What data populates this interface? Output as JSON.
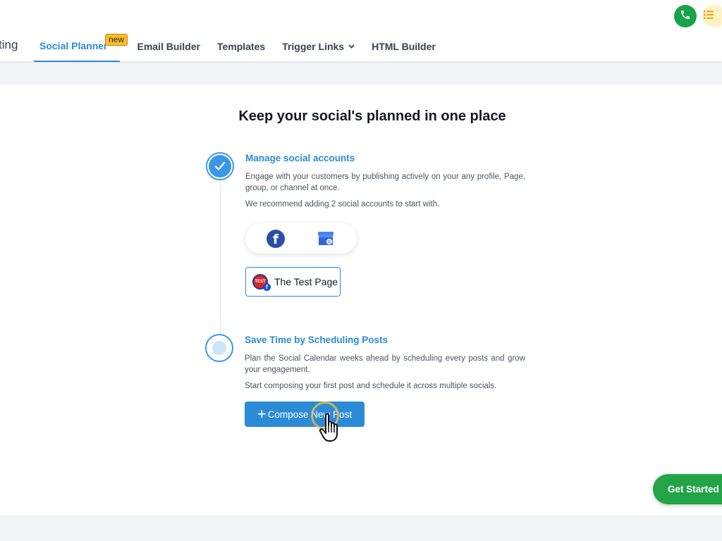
{
  "colors": {
    "accent": "#2b8bd6",
    "badge": "#fbbf24",
    "call_green": "#16a34a",
    "get_started_green": "#22a447"
  },
  "header": {
    "truncated_nav_text": "ting",
    "nav": [
      {
        "label": "Social Planner",
        "badge": "new",
        "active": true
      },
      {
        "label": "Email Builder"
      },
      {
        "label": "Templates"
      },
      {
        "label": "Trigger Links",
        "icon": "chevron-down-icon"
      },
      {
        "label": "HTML Builder"
      }
    ],
    "actions": [
      {
        "icon": "phone-icon"
      },
      {
        "icon": "list-icon"
      }
    ]
  },
  "main": {
    "headline": "Keep your social's planned in one place",
    "steps": [
      {
        "title": "Manage social accounts",
        "description": "Engage with your customers by publishing actively on your any profile, Page, group, or channel at once.",
        "note": "We recommend adding 2 social accounts to start with.",
        "status": "complete",
        "social_options": [
          {
            "icon": "facebook-icon",
            "glyph": "f"
          },
          {
            "icon": "google-business-icon"
          }
        ],
        "connected_page": {
          "name": "The Test Page",
          "avatar_text": "TEST",
          "network_glyph": "f"
        }
      },
      {
        "title": "Save Time by Scheduling Posts",
        "description": "Plan the Social Calendar weeks ahead by scheduling every posts and grow your engagement.",
        "note": "Start composing your first post and schedule it across multiple socials.",
        "status": "current",
        "button_label": "Compose New Post",
        "button_icon_glyph": "+"
      }
    ]
  },
  "floating": {
    "get_started_label": "Get Started"
  }
}
